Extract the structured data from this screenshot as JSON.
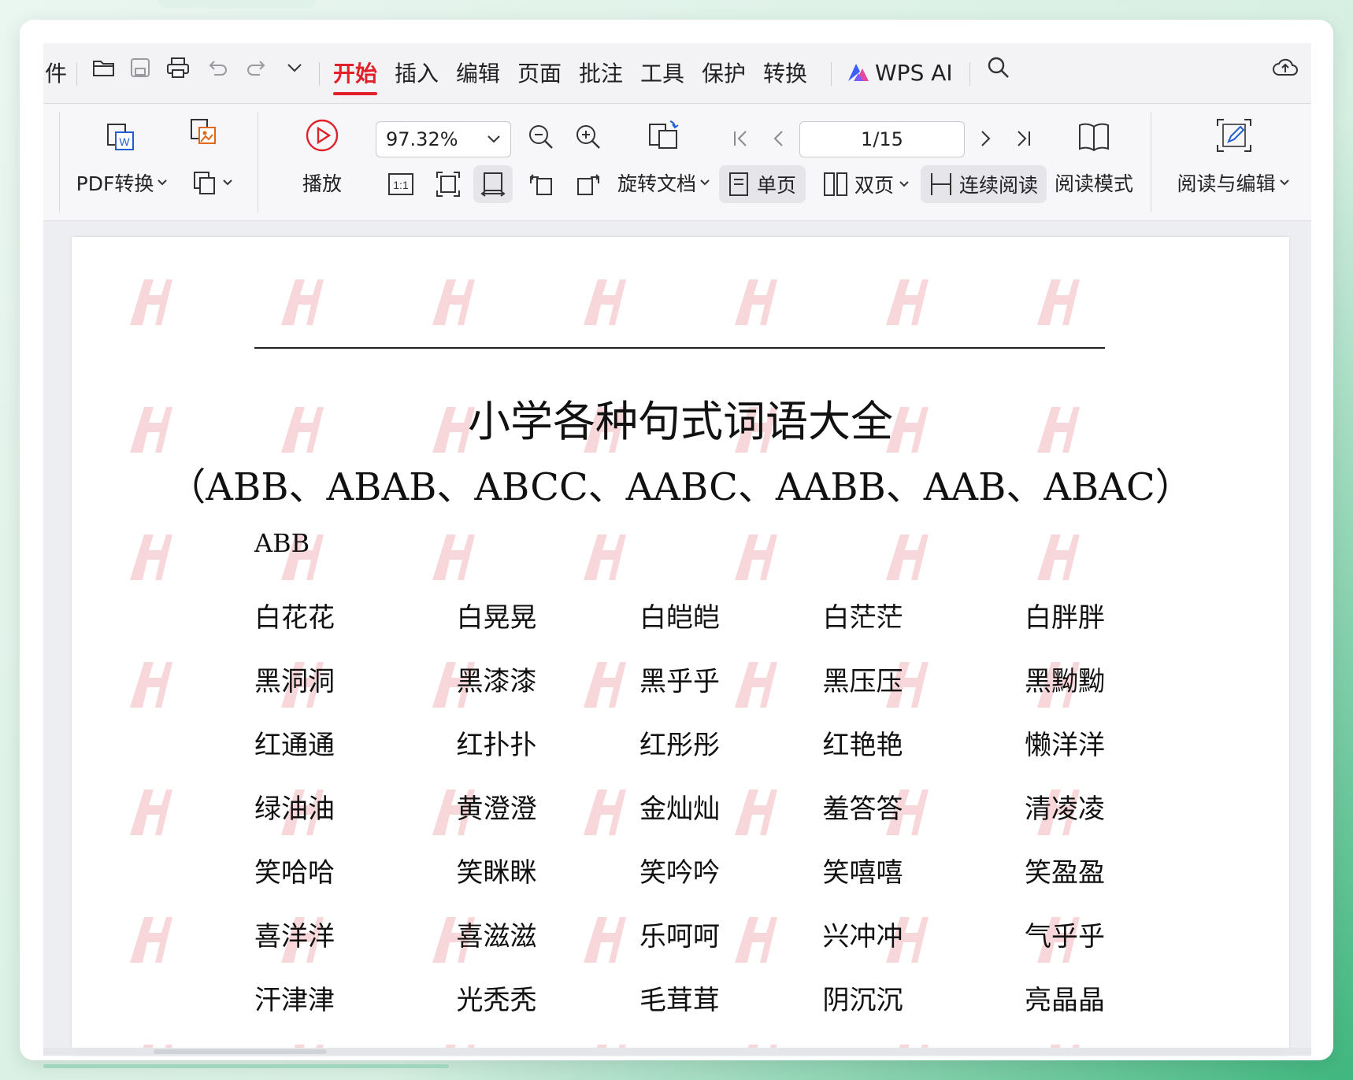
{
  "titlebar": {
    "file_menu_fragment": "件",
    "tabs": [
      {
        "label": "开始",
        "active": true
      },
      {
        "label": "插入",
        "active": false
      },
      {
        "label": "编辑",
        "active": false
      },
      {
        "label": "页面",
        "active": false
      },
      {
        "label": "批注",
        "active": false
      },
      {
        "label": "工具",
        "active": false
      },
      {
        "label": "保护",
        "active": false
      },
      {
        "label": "转换",
        "active": false
      }
    ],
    "ai_label": "WPS AI",
    "accent_color": "#e2202a"
  },
  "ribbon": {
    "pdf_convert_label": "PDF转换",
    "play_label": "播放",
    "zoom_value": "97.32%",
    "rotate_label": "旋转文档",
    "page_indicator": "1/15",
    "single_page_label": "单页",
    "double_page_label": "双页",
    "continuous_label": "连续阅读",
    "read_mode_label": "阅读模式",
    "read_edit_label": "阅读与编辑",
    "actual_size_label": "1:1"
  },
  "document": {
    "title": "小学各种句式词语大全",
    "subtitle": "（ABB、ABAB、ABCC、AABC、AABB、AAB、ABAC）",
    "section": "ABB",
    "rows": [
      [
        "白花花",
        "白晃晃",
        "白皑皑",
        "白茫茫",
        "白胖胖"
      ],
      [
        "黑洞洞",
        "黑漆漆",
        "黑乎乎",
        "黑压压",
        "黑黝黝"
      ],
      [
        "红通通",
        "红扑扑",
        "红彤彤",
        "红艳艳",
        "懒洋洋"
      ],
      [
        "绿油油",
        "黄澄澄",
        "金灿灿",
        "羞答答",
        "清凌凌"
      ],
      [
        "笑哈哈",
        "笑眯眯",
        "笑吟吟",
        "笑嘻嘻",
        "笑盈盈"
      ],
      [
        "喜洋洋",
        "喜滋滋",
        "乐呵呵",
        "兴冲冲",
        "气乎乎"
      ],
      [
        "汗津津",
        "光秃秃",
        "毛茸茸",
        "阴沉沉",
        "亮晶晶"
      ]
    ]
  }
}
